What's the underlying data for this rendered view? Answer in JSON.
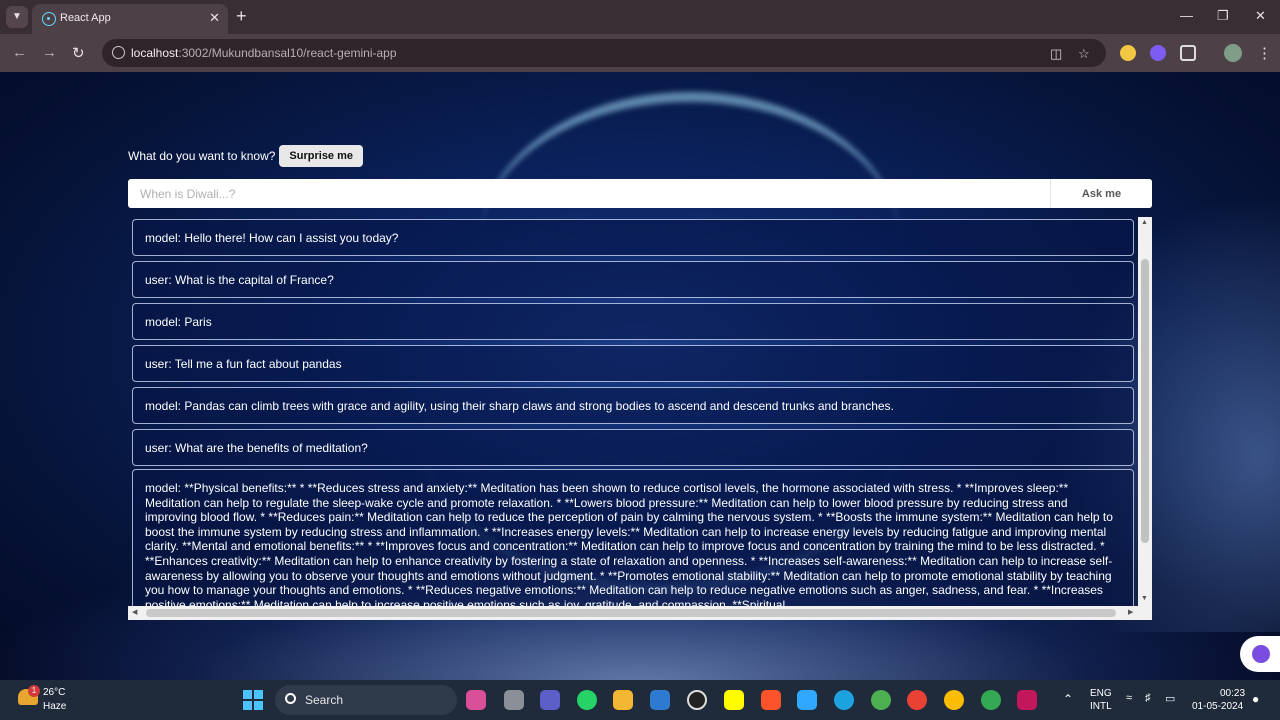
{
  "browser": {
    "tab_title": "React App",
    "url_host": "localhost",
    "url_rest": ":3002/Mukundbansal10/react-gemini-app"
  },
  "app": {
    "prompt_label": "What do you want to know?",
    "surprise_label": "Surprise me",
    "input_placeholder": "When is Diwali...?",
    "ask_label": "Ask me"
  },
  "chat": {
    "messages": [
      "model: Hello there! How can I assist you today?",
      "user: What is the capital of France?",
      "model: Paris",
      "user: Tell me a fun fact about pandas",
      "model: Pandas can climb trees with grace and agility, using their sharp claws and strong bodies to ascend and descend trunks and branches.",
      "user: What are the benefits of meditation?",
      "model: **Physical benefits:** * **Reduces stress and anxiety:** Meditation has been shown to reduce cortisol levels, the hormone associated with stress. * **Improves sleep:** Meditation can help to regulate the sleep-wake cycle and promote relaxation. * **Lowers blood pressure:** Meditation can help to lower blood pressure by reducing stress and improving blood flow. * **Reduces pain:** Meditation can help to reduce the perception of pain by calming the nervous system. * **Boosts the immune system:** Meditation can help to boost the immune system by reducing stress and inflammation. * **Increases energy levels:** Meditation can help to increase energy levels by reducing fatigue and improving mental clarity. **Mental and emotional benefits:** * **Improves focus and concentration:** Meditation can help to improve focus and concentration by training the mind to be less distracted. * **Enhances creativity:** Meditation can help to enhance creativity by fostering a state of relaxation and openness. * **Increases self-awareness:** Meditation can help to increase self-awareness by allowing you to observe your thoughts and emotions without judgment. * **Promotes emotional stability:** Meditation can help to promote emotional stability by teaching you how to manage your thoughts and emotions. * **Reduces negative emotions:** Meditation can help to reduce negative emotions such as anger, sadness, and fear. * **Increases positive emotions:** Meditation can help to increase positive emotions such as joy, gratitude, and compassion. **Spiritual"
    ]
  },
  "taskbar": {
    "weather_temp": "26°C",
    "weather_desc": "Haze",
    "weather_badge": "1",
    "search_label": "Search",
    "lang_top": "ENG",
    "lang_bottom": "INTL",
    "time": "00:23",
    "date": "01-05-2024"
  },
  "icons": {
    "tab_favicon": "react-logo-icon",
    "start": "windows-start-icon",
    "accent_color": "#4cc2ff"
  }
}
